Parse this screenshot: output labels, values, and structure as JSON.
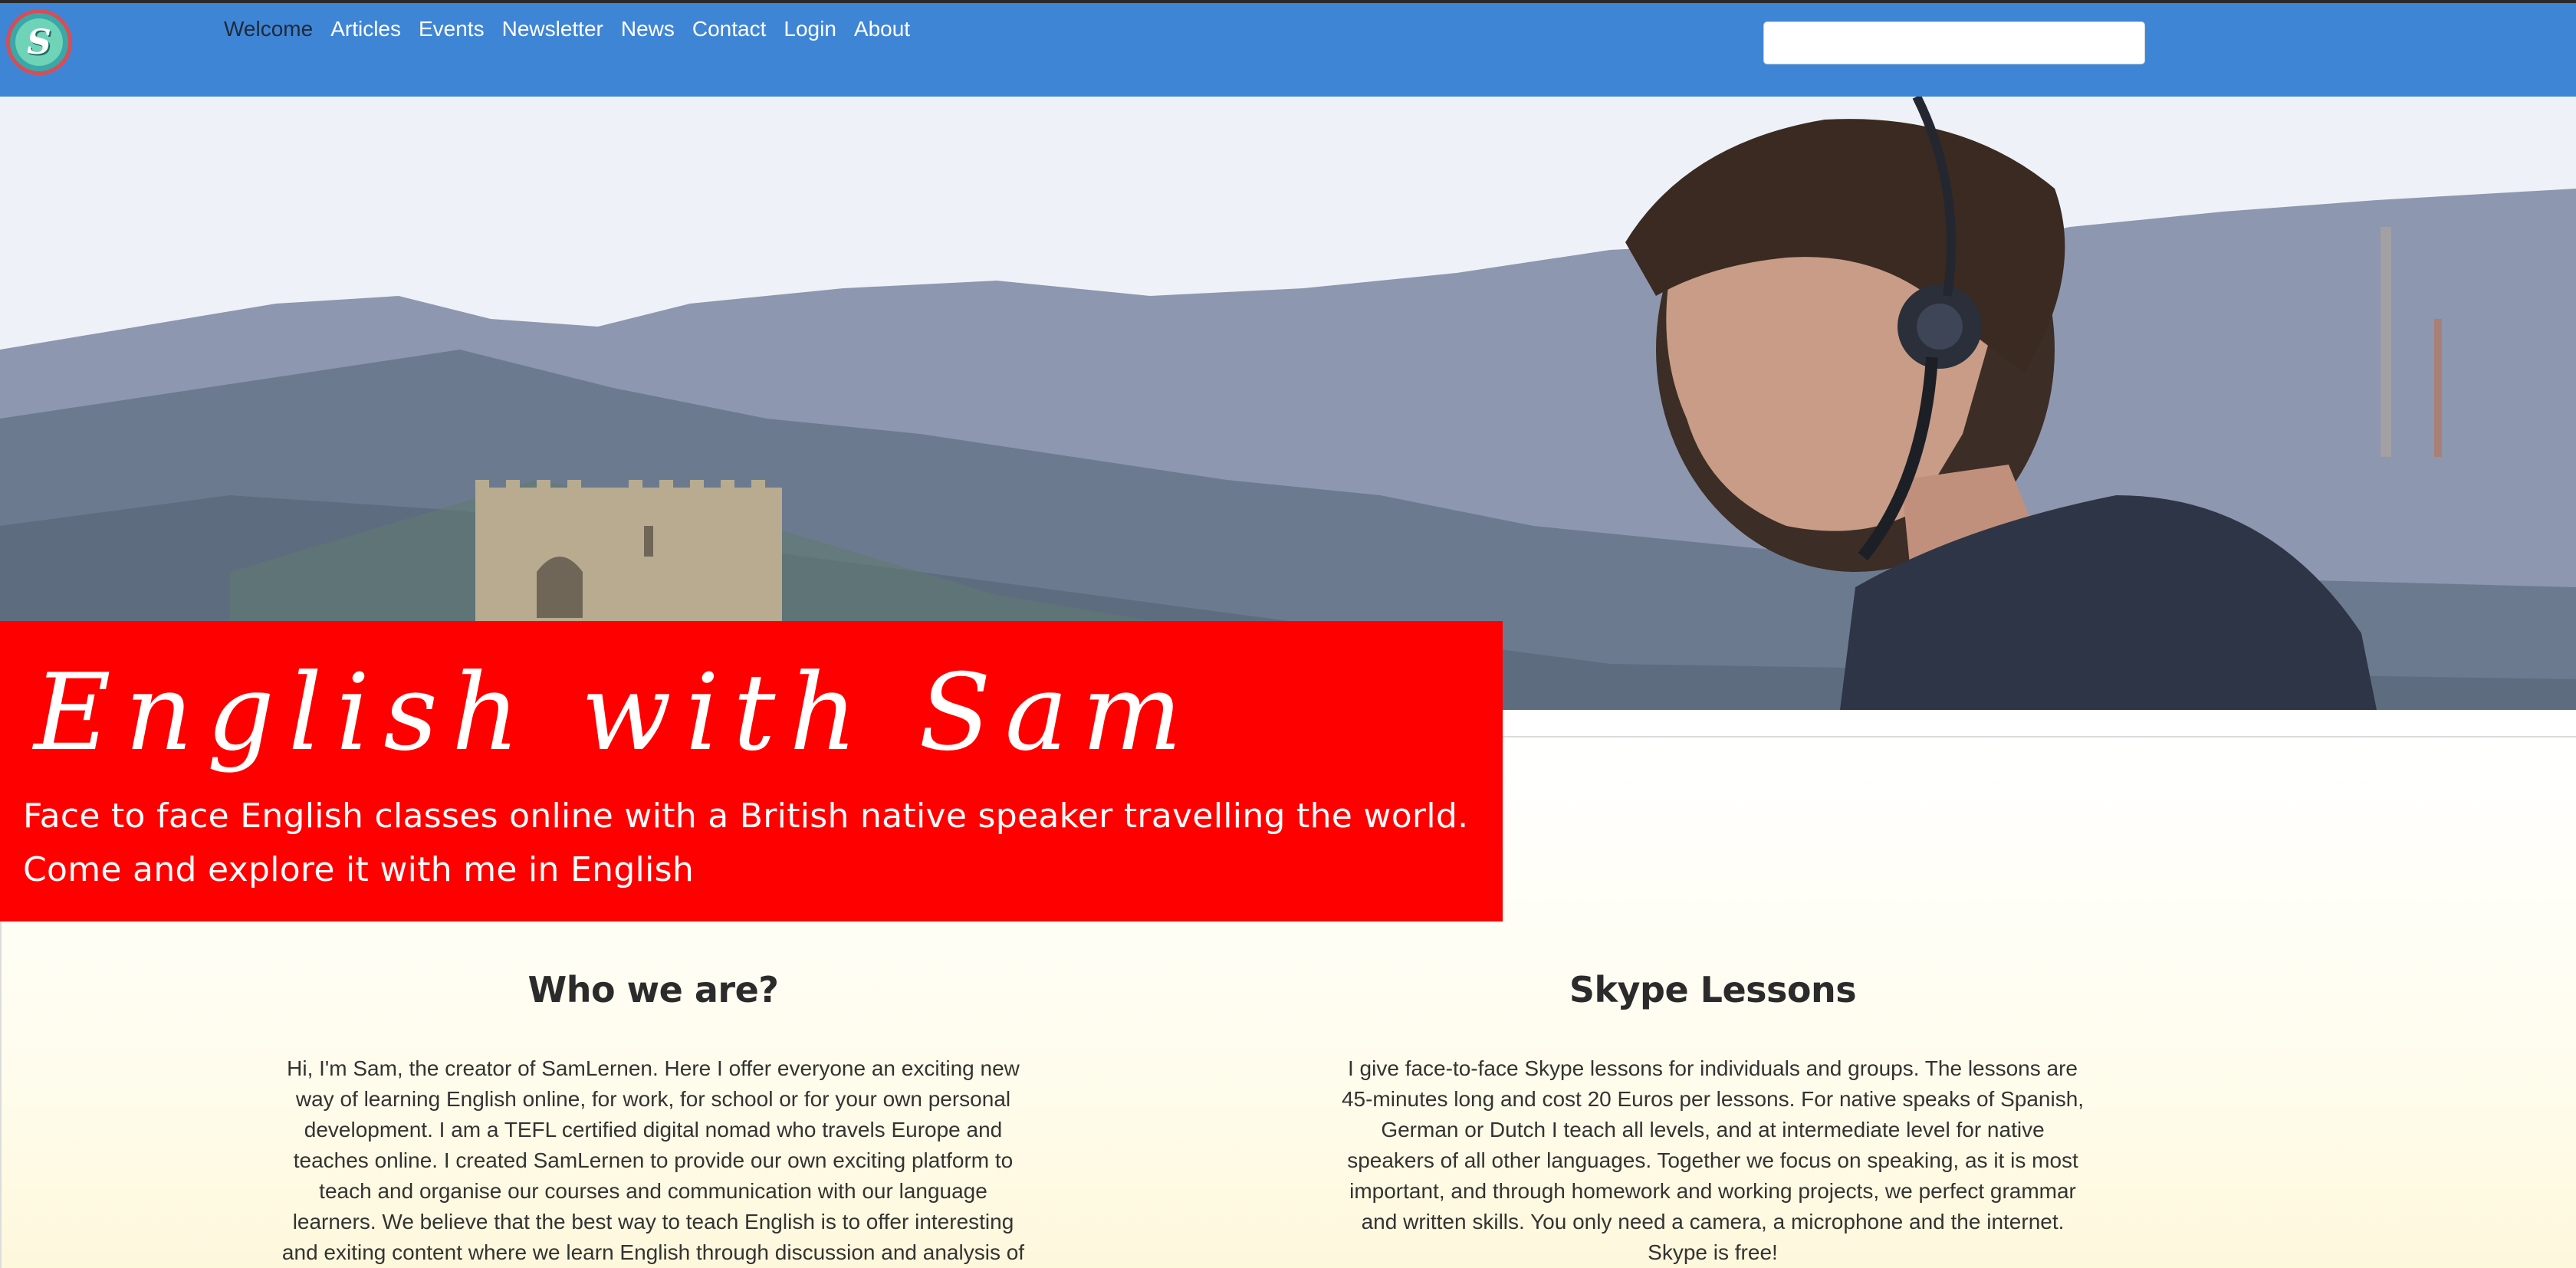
{
  "nav": {
    "logo_letter": "S",
    "links": [
      "Welcome",
      "Articles",
      "Events",
      "Newsletter",
      "News",
      "Contact",
      "Login",
      "About"
    ],
    "active": "Welcome",
    "search_placeholder": ""
  },
  "hero": {
    "title": "English with Sam",
    "subtitle": "Face to face English classes online with a British native speaker travelling the world. Come and explore it with me in English"
  },
  "sections": {
    "left": {
      "heading": "Who we are?",
      "body": "Hi, I'm Sam, the creator of SamLernen. Here I offer everyone an exciting new way of learning English online, for work, for school or for your own personal development. I am a TEFL certified digital nomad who travels Europe and teaches online. I created SamLernen to provide our own exciting platform to teach and organise our courses and communication with our language learners. We believe that the best way to teach English is to offer interesting and exiting content where we learn English through discussion and analysis of"
    },
    "right": {
      "heading": "Skype Lessons",
      "body": "I give face-to-face Skype lessons for individuals and groups. The lessons are 45-minutes long and cost 20 Euros per lessons. For native speaks of Spanish, German or Dutch I teach all levels, and at intermediate level for native speakers of all other languages. Together we focus on speaking, as it is most important, and through homework and working projects, we perfect grammar and written skills. You only need a camera, a microphone and the internet. Skype is free!"
    }
  },
  "colors": {
    "navbar": "#3f85d6",
    "title_box": "#ff0000"
  }
}
